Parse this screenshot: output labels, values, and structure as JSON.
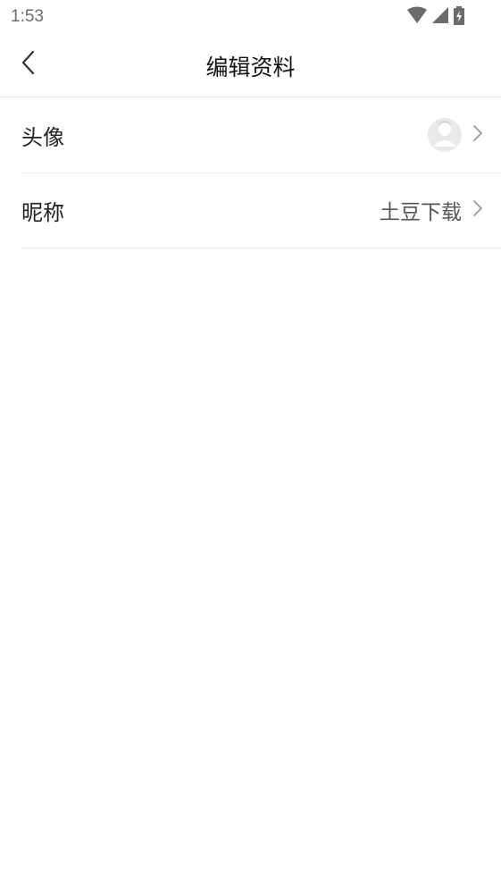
{
  "status_bar": {
    "time": "1:53",
    "icons": [
      "wifi-icon",
      "cellular-signal-icon",
      "battery-charging-icon"
    ]
  },
  "nav": {
    "title": "编辑资料",
    "back_icon": "chevron-left-icon"
  },
  "rows": [
    {
      "label": "头像",
      "value": "",
      "icon": "avatar-placeholder-icon"
    },
    {
      "label": "昵称",
      "value": "土豆下载"
    }
  ],
  "colors": {
    "divider": "#e2e2e2",
    "text": "#222222",
    "secondary_text": "#555555",
    "chevron": "#9a9a9a"
  }
}
